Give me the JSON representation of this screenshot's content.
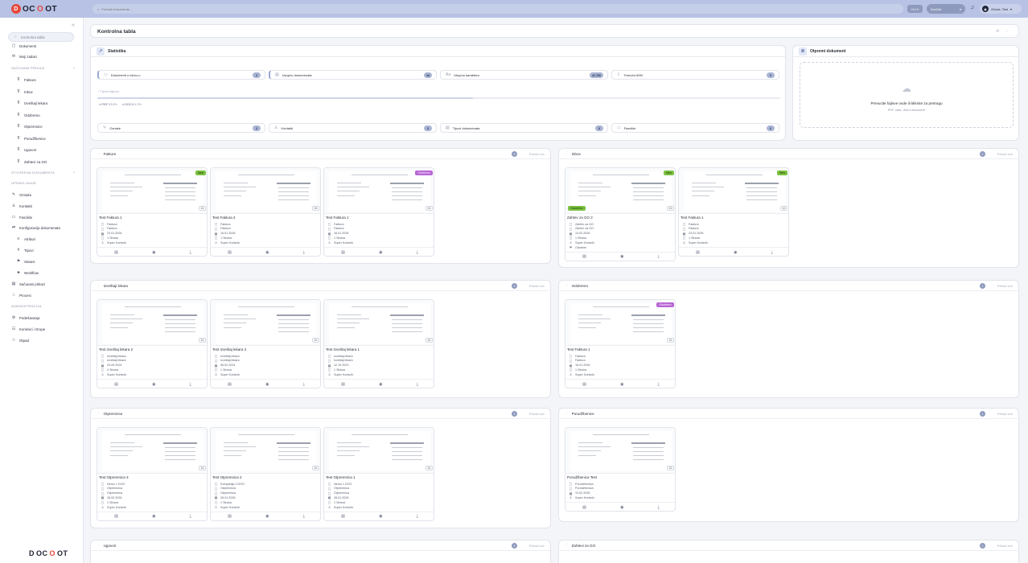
{
  "app": {
    "brand_left": "D",
    "brand_mid": "OC",
    "brand_o": "O",
    "brand_right": "OT"
  },
  "topbar": {
    "search_placeholder": "Pretraži dokumente...",
    "kbd": "Ctrl K",
    "tenant": "DocDot",
    "user": "Orlock, Test"
  },
  "sidebar": {
    "items": [
      {
        "label": "Kontrolna tabla",
        "icon": "dashboard-icon"
      },
      {
        "label": "Dokumenti",
        "icon": "document-icon"
      },
      {
        "label": "Moji zadaci",
        "icon": "tasks-icon"
      },
      {
        "label": "SAČUVANI PRIKAZI",
        "icon": "chevron-icon"
      },
      {
        "label": "Fakture",
        "icon": "filter-icon"
      },
      {
        "label": "Inbox",
        "icon": "filter-icon"
      },
      {
        "label": "Izveštaji lekara",
        "icon": "filter-icon"
      },
      {
        "label": "Odobreno",
        "icon": "filter-icon"
      },
      {
        "label": "Otpremnice",
        "icon": "filter-icon"
      },
      {
        "label": "Porudžbenice",
        "icon": "filter-icon"
      },
      {
        "label": "Ugovori",
        "icon": "filter-icon"
      },
      {
        "label": "Zahtevi za GO",
        "icon": "filter-icon"
      },
      {
        "label": "OTVORENA DOKUMENTA",
        "icon": "chevron-icon"
      },
      {
        "label": "UPRAVLJANJE",
        "icon": ""
      },
      {
        "label": "Oznake",
        "icon": "tag-icon"
      },
      {
        "label": "Kontakti",
        "icon": "contact-icon"
      },
      {
        "label": "Fascikle",
        "icon": "folder-icon"
      },
      {
        "label": "Konfiguracija dokumenata",
        "icon": "config-icon"
      },
      {
        "label": "Atributi",
        "icon": "attribute-icon"
      },
      {
        "label": "Tipovi",
        "icon": "hash-icon"
      },
      {
        "label": "Statusi",
        "icon": "flag-icon"
      },
      {
        "label": "Workflow",
        "icon": "workflow-icon"
      },
      {
        "label": "Sačuvani prikazi",
        "icon": "saved-icon"
      },
      {
        "label": "Procesi",
        "icon": "process-icon"
      },
      {
        "label": "ADMINISTRACIJA",
        "icon": ""
      },
      {
        "label": "Podešavanja",
        "icon": "gear-icon"
      },
      {
        "label": "Korisnici i Grupe",
        "icon": "users-icon"
      },
      {
        "label": "Otpad",
        "icon": "trash-icon"
      }
    ]
  },
  "page": {
    "title": "Kontrolna tabla"
  },
  "stats": {
    "title": "Statistika",
    "row1": [
      {
        "label": "Dokumenti u inbox-u",
        "value": "2"
      },
      {
        "label": "Ukupno dokumenata",
        "value": "16"
      },
      {
        "label": "Ukupno karaktera",
        "value": "41.766"
      },
      {
        "label": "Trenutni ASN",
        "value": "0"
      }
    ],
    "types_label": "Tipovi fajlova",
    "types": [
      {
        "name": "PDF",
        "pct": "93.8%"
      },
      {
        "name": "DOCX",
        "pct": "6.3%"
      }
    ],
    "row2": [
      {
        "label": "Oznake",
        "value": "2"
      },
      {
        "label": "Kontakti",
        "value": "3"
      },
      {
        "label": "Tipovi dokumenata",
        "value": "6"
      },
      {
        "label": "Fascikle",
        "value": "6"
      }
    ]
  },
  "upload": {
    "title": "Otpremi dokument",
    "line1": "Prevucite fajlove ovde ili kliknite za pretragu",
    "line2": "PDF, slike, Word dokumenti"
  },
  "show_all": "Prikaži sve",
  "sections": [
    {
      "title": "Fakture",
      "count": "3",
      "docs": [
        {
          "title": "Test Faktura 1",
          "tag": "New",
          "tag_color": "green",
          "meta": [
            "Faktura",
            "Faktura",
            "23.01.2026",
            "1 Strana",
            "Super Korisnik"
          ]
        },
        {
          "title": "Test Faktura 2",
          "tag": "",
          "meta": [
            "Faktura",
            "Faktura",
            "16.01.2026",
            "1 Strana",
            "Super Korisnik"
          ]
        },
        {
          "title": "Test Faktura 1",
          "tag": "Odobreno",
          "tag_color": "purple",
          "meta": [
            "Faktura",
            "Faktura",
            "16.01.2026",
            "1 Strana",
            "Super Korisnik"
          ]
        }
      ]
    },
    {
      "title": "Inbox",
      "count": "2",
      "docs": [
        {
          "title": "Zahtev za GO 2",
          "tag": "New",
          "tag_color": "green",
          "tag_left": "Odobreno",
          "meta": [
            "Zahtev za GO",
            "Zahtev za GO",
            "13.02.2026",
            "1 Strana",
            "Super Korisnik",
            "Odobren"
          ]
        },
        {
          "title": "Test Faktura 1",
          "tag": "New",
          "tag_color": "green",
          "meta": [
            "Faktura",
            "Faktura",
            "23.01.2026",
            "1 Strana",
            "Super Korisnik"
          ]
        }
      ]
    },
    {
      "title": "Izveštaji lekara",
      "count": "3",
      "docs": [
        {
          "title": "Test Izveštaj lekara 2",
          "tag": "",
          "meta": [
            "Izveštaj lekara",
            "Izveštaj lekara",
            "20.09.2024",
            "4 Strana",
            "Super Korisnik"
          ]
        },
        {
          "title": "Test Izveštaj lekara 3",
          "tag": "",
          "meta": [
            "Izveštaj lekara",
            "Izveštaj lekara",
            "06.02.2024",
            "1 Strana",
            "Super Korisnik"
          ]
        },
        {
          "title": "Test Izveštaj lekara 1",
          "tag": "",
          "meta": [
            "Izveštaj lekara",
            "Izveštaj lekara",
            "12.10.2023",
            "1 Strana",
            "Super Korisnik"
          ]
        }
      ]
    },
    {
      "title": "Odobreno",
      "count": "1",
      "docs": [
        {
          "title": "Test Faktura 1",
          "tag": "Odobreno",
          "tag_color": "purple",
          "meta": [
            "Faktura",
            "Faktura",
            "16.01.2026",
            "1 Strana",
            "Super Korisnik"
          ]
        }
      ]
    },
    {
      "title": "Otpremnice",
      "count": "3",
      "docs": [
        {
          "title": "Test Otpremnica 3",
          "tag": "",
          "meta": [
            "Nemo 1 DOO",
            "Otpremnica",
            "Otpremnica",
            "18.02.2026",
            "1 Strana",
            "Super Korisnik"
          ]
        },
        {
          "title": "Test Otpremnica 2",
          "tag": "",
          "meta": [
            "Kompanija 2 DOO",
            "Otpremnica",
            "Otpremnica",
            "28.01.2026",
            "1 Strana",
            "Super Korisnik"
          ]
        },
        {
          "title": "Test Otpremnica 1",
          "tag": "",
          "meta": [
            "Nemo 1 DOO",
            "Otpremnica",
            "Otpremnica",
            "28.01.2026",
            "1 Strana",
            "Super Korisnik"
          ]
        }
      ]
    },
    {
      "title": "Porudžbenice",
      "count": "1",
      "docs": [
        {
          "title": "Porudžbenica Test",
          "tag": "",
          "meta": [
            "Porudžbenica",
            "Porudžbenica",
            "13.02.2026",
            "Super Korisnik"
          ]
        }
      ]
    },
    {
      "title": "Ugovori",
      "count": "3",
      "docs": []
    },
    {
      "title": "Zahtevi za GO",
      "count": "2",
      "docs": []
    }
  ]
}
